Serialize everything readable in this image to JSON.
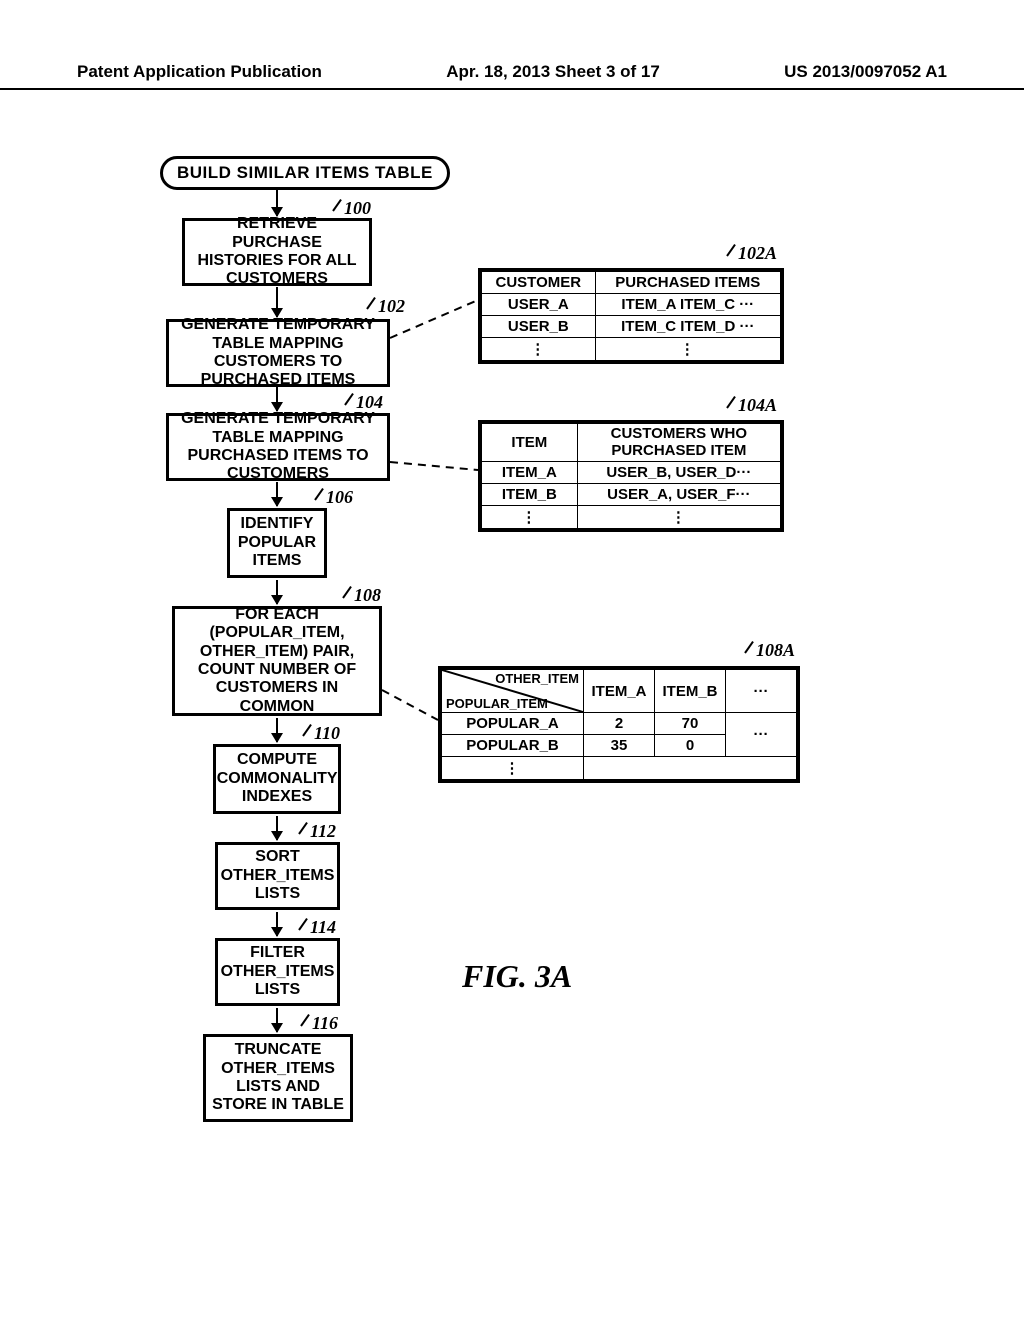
{
  "header": {
    "left": "Patent Application Publication",
    "center": "Apr. 18, 2013  Sheet 3 of 17",
    "right": "US 2013/0097052 A1"
  },
  "flow": {
    "title": "BUILD SIMILAR ITEMS TABLE",
    "steps": {
      "s100": "RETRIEVE PURCHASE HISTORIES FOR ALL CUSTOMERS",
      "s102": "GENERATE TEMPORARY TABLE MAPPING CUSTOMERS TO PURCHASED ITEMS",
      "s104": "GENERATE TEMPORARY TABLE MAPPING PURCHASED ITEMS TO CUSTOMERS",
      "s106": "IDENTIFY POPULAR ITEMS",
      "s108": "FOR EACH (POPULAR_ITEM, OTHER_ITEM) PAIR, COUNT NUMBER OF CUSTOMERS IN COMMON",
      "s110": "COMPUTE COMMONALITY INDEXES",
      "s112": "SORT OTHER_ITEMS LISTS",
      "s114": "FILTER OTHER_ITEMS LISTS",
      "s116": "TRUNCATE OTHER_ITEMS LISTS AND STORE IN TABLE"
    },
    "refs": {
      "r100": "100",
      "r102": "102",
      "r102A": "102A",
      "r104": "104",
      "r104A": "104A",
      "r106": "106",
      "r108": "108",
      "r108A": "108A",
      "r110": "110",
      "r112": "112",
      "r114": "114",
      "r116": "116"
    }
  },
  "tables": {
    "t102A": {
      "h1": "CUSTOMER",
      "h2": "PURCHASED ITEMS",
      "r1c1": "USER_A",
      "r1c2": "ITEM_A ITEM_C ···",
      "r2c1": "USER_B",
      "r2c2": "ITEM_C ITEM_D ···"
    },
    "t104A": {
      "h1": "ITEM",
      "h2": "CUSTOMERS WHO PURCHASED ITEM",
      "r1c1": "ITEM_A",
      "r1c2": "USER_B, USER_D···",
      "r2c1": "ITEM_B",
      "r2c2": "USER_A, USER_F···"
    },
    "t108A": {
      "diag_top": "OTHER_ITEM",
      "diag_bottom": "POPULAR_ITEM",
      "c1": "ITEM_A",
      "c2": "ITEM_B",
      "c3": "···",
      "r1": "POPULAR_A",
      "r1c1": "2",
      "r1c2": "70",
      "r2": "POPULAR_B",
      "r2c1": "35",
      "r2c2": "0",
      "r2c3": "···"
    }
  },
  "figure_label": "FIG.  3A"
}
